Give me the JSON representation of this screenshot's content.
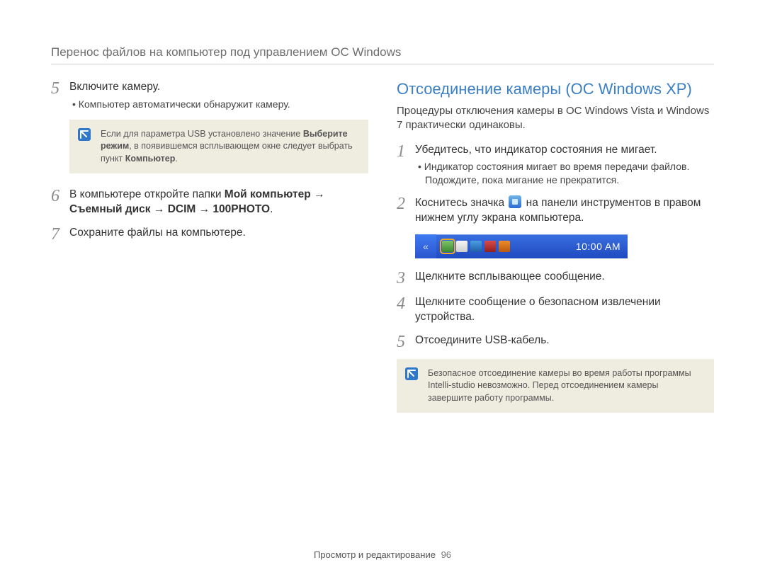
{
  "header": {
    "title": "Перенос файлов на компьютер под управлением ОС Windows"
  },
  "left": {
    "steps": {
      "five": {
        "num": "5",
        "text": "Включите камеру.",
        "bullet": "Компьютер автоматически обнаружит камеру."
      },
      "six": {
        "num": "6",
        "pre": "В компьютере откройте папки ",
        "path1": "Мой компьютер",
        "arrow1": " → ",
        "path2": "Съемный диск",
        "arrow2": " → ",
        "path3": "DCIM",
        "arrow3": " → ",
        "path4": "100PHOTO",
        "suffix": "."
      },
      "seven": {
        "num": "7",
        "text": "Сохраните файлы на компьютере."
      }
    },
    "note": {
      "pre": "Если для параметра USB установлено значение ",
      "bold1": "Выберите режим",
      "mid": ", в появившемся всплывающем окне следует выбрать пункт ",
      "bold2": "Компьютер",
      "suffix": "."
    }
  },
  "right": {
    "heading": "Отсоединение камеры (ОС Windows XP)",
    "intro": "Процедуры отключения камеры в ОС Windows Vista и Windows 7 практически одинаковы.",
    "steps": {
      "one": {
        "num": "1",
        "text": "Убедитесь, что индикатор состояния не мигает.",
        "bullet": "Индикатор состояния мигает во время передачи файлов. Подождите, пока мигание не прекратится."
      },
      "two": {
        "num": "2",
        "pre": "Коснитесь значка ",
        "post": " на панели инструментов в правом нижнем углу экрана компьютера."
      },
      "three": {
        "num": "3",
        "text": "Щелкните всплывающее сообщение."
      },
      "four": {
        "num": "4",
        "text": "Щелкните сообщение о безопасном извлечении устройства."
      },
      "five": {
        "num": "5",
        "text": "Отсоедините USB-кабель."
      }
    },
    "taskbar": {
      "clock": "10:00 AM",
      "icons": [
        "eject-icon",
        "check-icon",
        "monitor-icon",
        "speaker-icon",
        "shield-icon"
      ]
    },
    "note": "Безопасное отсоединение камеры во время работы программы Intelli-studio невозможно. Перед отсоединением камеры завершите работу программы."
  },
  "footer": {
    "section": "Просмотр и редактирование",
    "page": "96"
  }
}
